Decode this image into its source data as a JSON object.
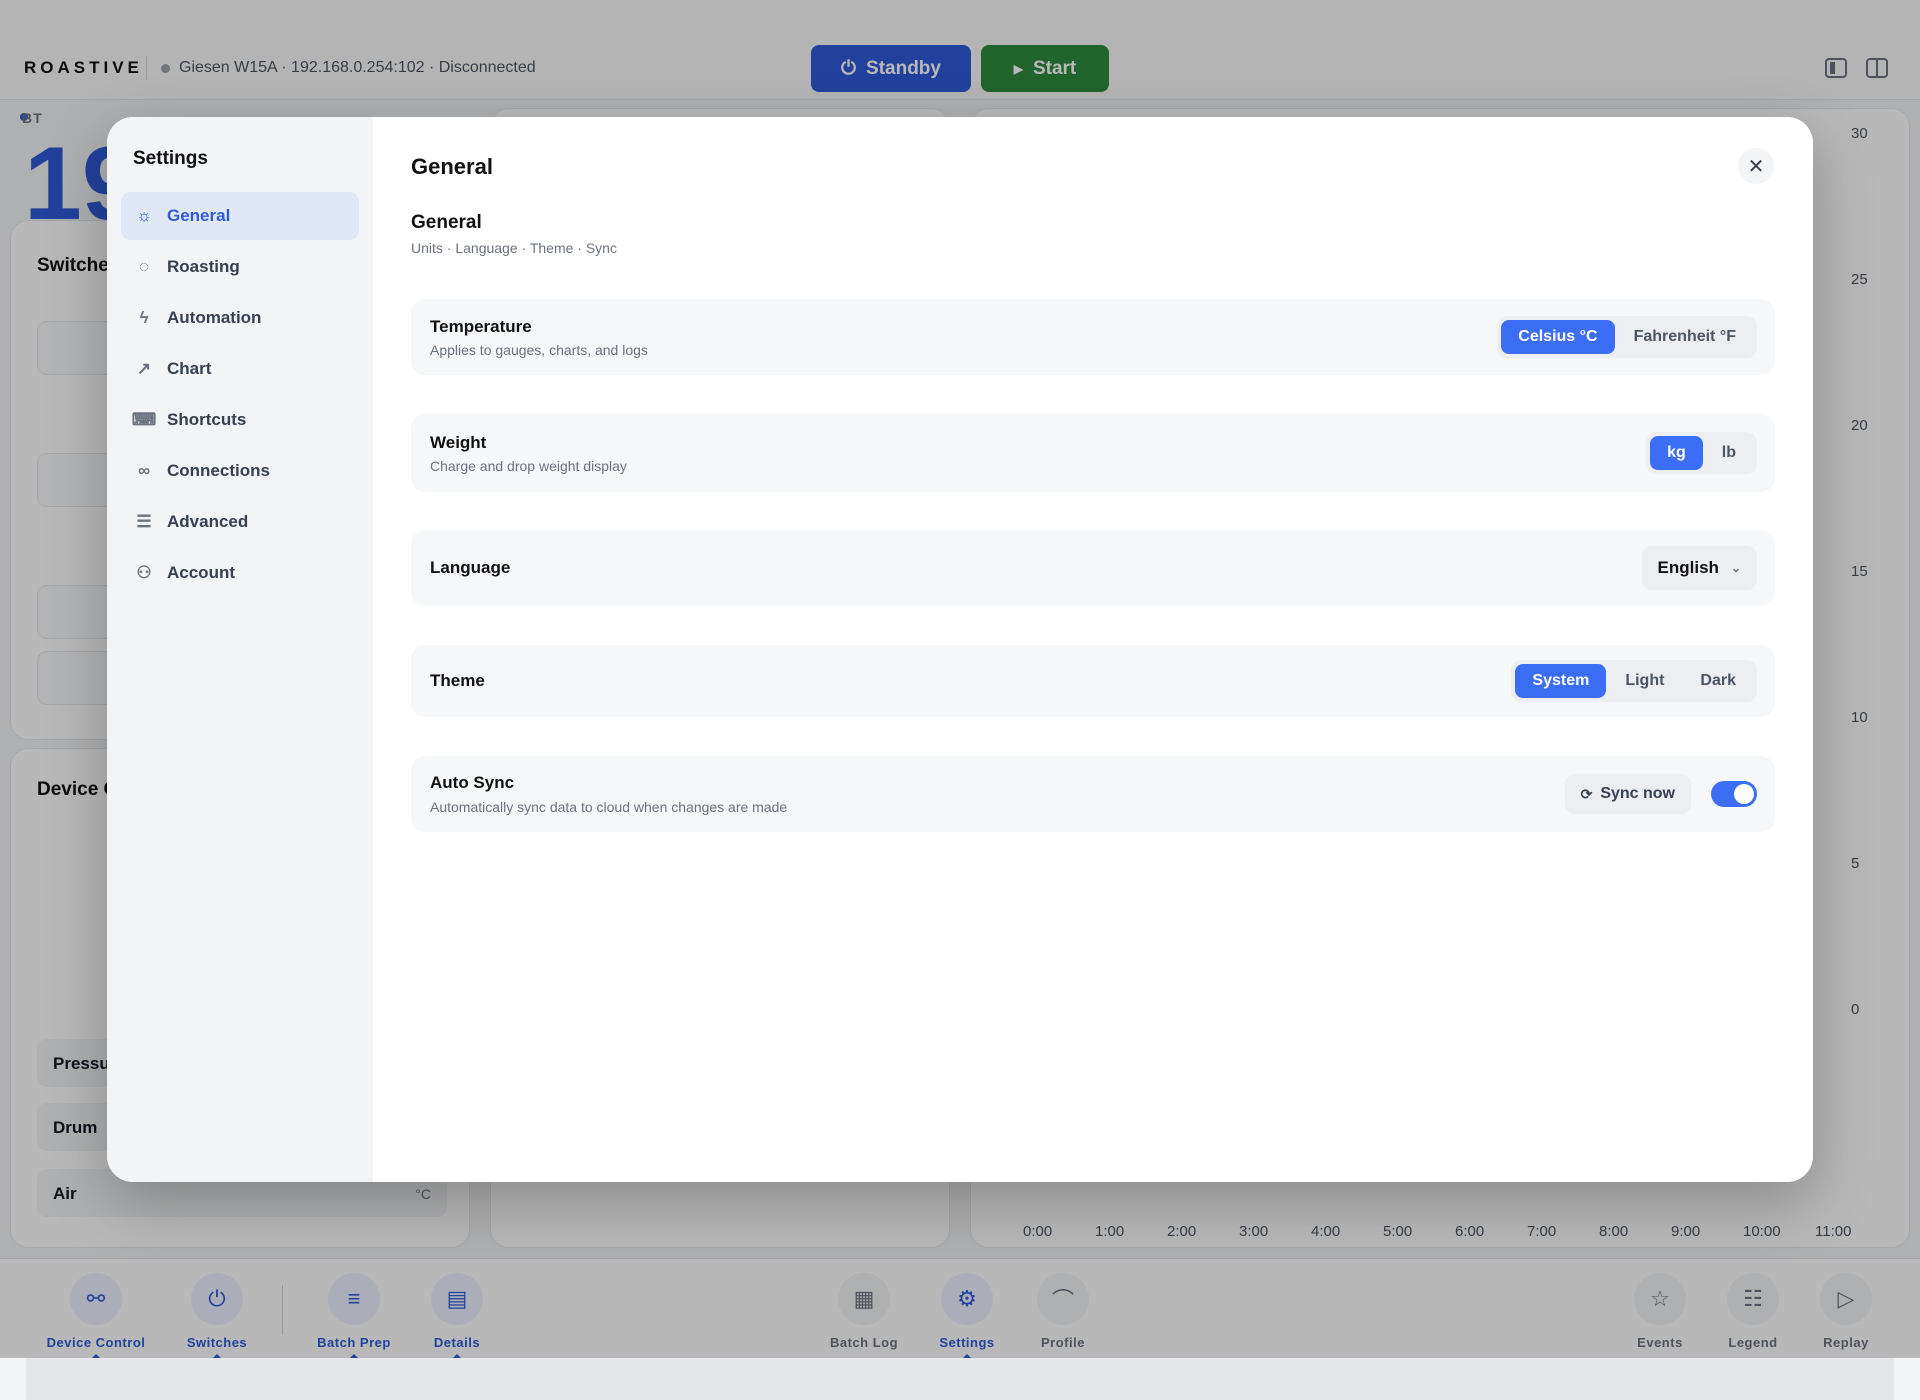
{
  "app": {
    "brand": "ROASTIVE",
    "connection": "Giesen W15A · 192.168.0.254:102 · Disconnected",
    "standby_label": "Standby",
    "start_label": "Start"
  },
  "background": {
    "bt_label": "BT",
    "bt_value": "19",
    "switches_title": "Switche",
    "device_title": "Device C",
    "rows": {
      "pressure": "Pressu",
      "drum": "Drum",
      "air": "Air"
    },
    "air_unit": "°C",
    "chart_y_ticks": [
      "30",
      "25",
      "20",
      "15",
      "10",
      "5",
      "0"
    ],
    "chart_x_ticks": [
      "0:00",
      "1:00",
      "2:00",
      "3:00",
      "4:00",
      "5:00",
      "6:00",
      "7:00",
      "8:00",
      "9:00",
      "10:00",
      "11:00"
    ]
  },
  "bottom_nav": {
    "device_control": "Device Control",
    "switches": "Switches",
    "batch_prep": "Batch Prep",
    "details": "Details",
    "batch_log": "Batch Log",
    "settings": "Settings",
    "profile": "Profile",
    "events": "Events",
    "legend": "Legend",
    "replay": "Replay"
  },
  "settings": {
    "title": "Settings",
    "nav": [
      {
        "label": "General",
        "icon": "sun-icon"
      },
      {
        "label": "Roasting",
        "icon": "drop-icon"
      },
      {
        "label": "Automation",
        "icon": "bolt-icon"
      },
      {
        "label": "Chart",
        "icon": "trend-icon"
      },
      {
        "label": "Shortcuts",
        "icon": "keyboard-icon"
      },
      {
        "label": "Connections",
        "icon": "link-icon"
      },
      {
        "label": "Advanced",
        "icon": "sliders-icon"
      },
      {
        "label": "Account",
        "icon": "user-icon"
      }
    ],
    "page_title": "General",
    "section_title": "General",
    "section_sub": "Units · Language · Theme · Sync",
    "temperature": {
      "label": "Temperature",
      "desc": "Applies to gauges, charts, and logs",
      "options": [
        "Celsius °C",
        "Fahrenheit °F"
      ],
      "selected": "Celsius °C"
    },
    "weight": {
      "label": "Weight",
      "desc": "Charge and drop weight display",
      "options": [
        "kg",
        "lb"
      ],
      "selected": "kg"
    },
    "language": {
      "label": "Language",
      "value": "English"
    },
    "theme": {
      "label": "Theme",
      "options": [
        "System",
        "Light",
        "Dark"
      ],
      "selected": "System"
    },
    "auto_sync": {
      "label": "Auto Sync",
      "desc": "Automatically sync data to cloud when changes are made",
      "sync_now_label": "Sync now",
      "enabled": true
    }
  },
  "colors": {
    "accent": "#3b6ef5",
    "standby": "#2f5bd8",
    "start": "#2e8b3e"
  }
}
